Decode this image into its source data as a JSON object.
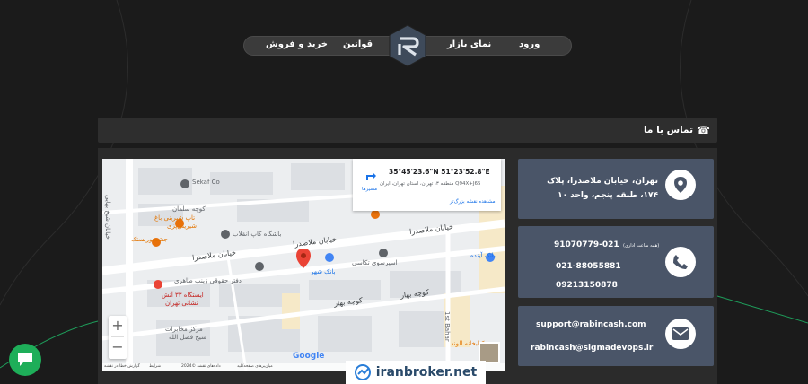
{
  "nav": {
    "items": [
      {
        "label": "ورود"
      },
      {
        "label": "نمای بازار"
      },
      {
        "label": "قوانین"
      },
      {
        "label": "خرید و فروش"
      }
    ]
  },
  "contact": {
    "title": "تماس با ما"
  },
  "map": {
    "coordinates": "35°45'23.6\"N 51°23'52.8\"E",
    "plus_code": "Q94X+J65 منطقه ۳، تهران، استان تهران، ایران",
    "route_label": "مسیرها",
    "view_larger": "مشاهده نقشه بزرگ‌تر",
    "labels": {
      "sekaf": "Sekaf Co",
      "salman": "کوچه سلمان",
      "shirini": "تاپ شیرینی باغ",
      "shirini_sub": "شیرینی‌پزی",
      "kebab": "جشنخوریستک",
      "bashgah": "باشگاه کاپ انقلاب",
      "mollasadra1": "خیابان ملاصدرا",
      "mollasadra2": "خیابان ملاصدرا",
      "mollasadra3": "خیابان ملاصدرا",
      "bank_shahr": "بانک شهر",
      "espresso": "اسپرسوی تکاسی",
      "bank_ayandeh": "بانک آینده",
      "daftar": "دفتر حقوقی زینب طاهری",
      "station": "ایستگاه ۳۳ آتش",
      "station_sub": "نشانی تهران",
      "bahar1": "کوچه بهار",
      "bahar2": "کوچه بهار",
      "markaz": "مرکز مخابرات",
      "markaz_sub": "شیخ فضل الله",
      "alvand": "کتابخانه الوند",
      "shiraz": "خیابان شیخ بهایی",
      "first_bahar": "1st Bahar"
    },
    "zoom_in": "+",
    "zoom_out": "−",
    "google": "Google",
    "footer": {
      "shortcuts": "میان‌برهای صفحه‌کلید",
      "data": "داده‌های نقشه ©2024",
      "terms": "شرایط",
      "report": "گزارش خطا در نقشه"
    }
  },
  "cards": {
    "address": "تهران، خیابان ملاصدرا، پلاک ۱۷۴، طبقه پنجم، واحد ۱۰",
    "phone_hours": "(همه ساعت اداری)",
    "phone1": "91070779-021",
    "phone2": "021-88055881",
    "phone3": "09213150878",
    "email1": "support@rabincash.com",
    "email2": "rabincash@sigmadevops.ir"
  },
  "footer": {
    "brand": "iranbroker.net"
  },
  "colors": {
    "background": "#1b1b1b",
    "card": "#4a5568",
    "chat": "#1eae59",
    "accent_line": "#1e9c5a"
  }
}
